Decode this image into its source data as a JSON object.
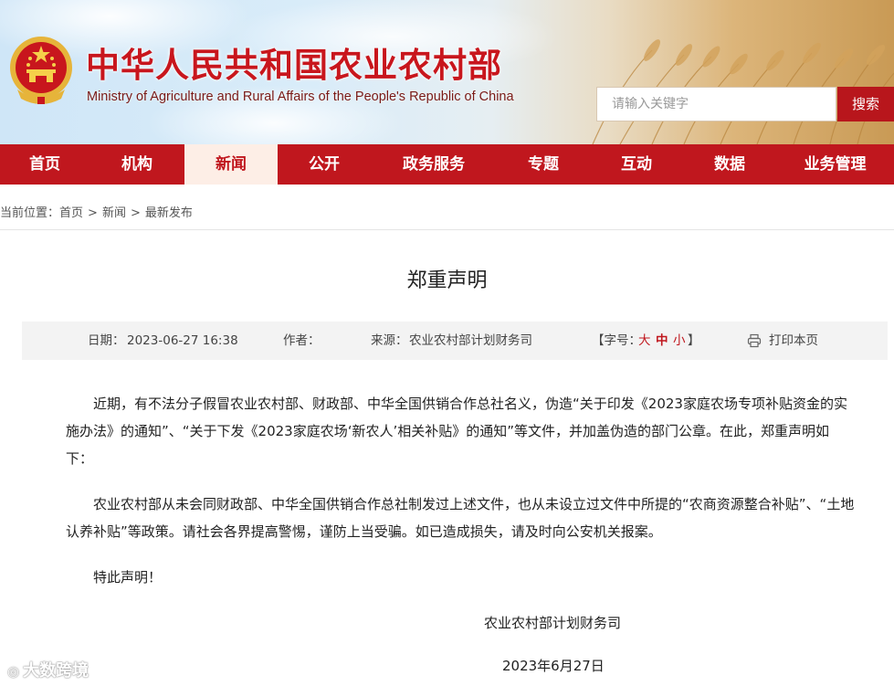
{
  "header": {
    "title_cn": "中华人民共和国农业农村部",
    "title_en": "Ministry of Agriculture and Rural Affairs of the People's Republic of China",
    "search_placeholder": "请输入关键字",
    "search_button": "搜索"
  },
  "nav": {
    "items": [
      "首页",
      "机构",
      "新闻",
      "公开",
      "政务服务",
      "专题",
      "互动",
      "数据",
      "业务管理"
    ],
    "active_index": 2
  },
  "breadcrumb": {
    "prefix": "当前位置：",
    "items": [
      "首页",
      "新闻",
      "最新发布"
    ],
    "separator": ">"
  },
  "article": {
    "title": "郑重声明",
    "meta": {
      "date_label": "日期：",
      "date": "2023-06-27 16:38",
      "author_label": "作者：",
      "source_label": "来源：",
      "source": "农业农村部计划财务司",
      "font_label": "【字号：",
      "font_large": "大",
      "font_medium": "中",
      "font_small": "小",
      "font_close": "】",
      "print": "打印本页"
    },
    "paragraphs": [
      "近期，有不法分子假冒农业农村部、财政部、中华全国供销合作总社名义，伪造“关于印发《2023家庭农场专项补贴资金的实施办法》的通知”、“关于下发《2023家庭农场‘新农人’相关补贴》的通知”等文件，并加盖伪造的部门公章。在此，郑重声明如下：",
      "农业农村部从未会同财政部、中华全国供销合作总社制发过上述文件，也从未设立过文件中所提的“农商资源整合补贴”、“土地认养补贴”等政策。请社会各界提高警惕，谨防上当受骗。如已造成损失，请及时向公安机关报案。"
    ],
    "closing": "特此声明！",
    "signature": "农业农村部计划财务司",
    "sign_date": "2023年6月27日"
  },
  "watermark": "大数跨境",
  "colors": {
    "brand_red": "#c0171e",
    "nav_active_bg": "#fdeee6"
  }
}
